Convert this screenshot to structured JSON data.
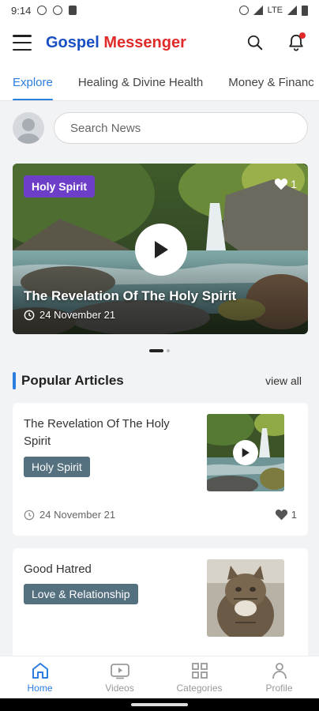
{
  "status_bar": {
    "time": "9:14",
    "network": "LTE"
  },
  "header": {
    "brand_part1": "Gospel",
    "brand_part2": "Messenger"
  },
  "tabs": [
    {
      "label": "Explore"
    },
    {
      "label": "Healing & Divine Health"
    },
    {
      "label": "Money & Financ"
    }
  ],
  "search": {
    "placeholder": "Search News"
  },
  "featured": {
    "tag": "Holy Spirit",
    "likes": "1",
    "title": "The Revelation Of The Holy Spirit",
    "date": "24 November 21"
  },
  "section": {
    "title": "Popular Articles",
    "view_all": "view all"
  },
  "articles": [
    {
      "title": "The Revelation Of The Holy Spirit",
      "tag": "Holy Spirit",
      "date": "24 November 21",
      "likes": "1"
    },
    {
      "title": "Good Hatred",
      "tag": "Love & Relationship"
    }
  ],
  "bottom_nav": [
    {
      "label": "Home"
    },
    {
      "label": "Videos"
    },
    {
      "label": "Categories"
    },
    {
      "label": "Profile"
    }
  ],
  "colors": {
    "accent": "#2b7de0",
    "brand_blue": "#1a4fc4",
    "brand_red": "#e02a2a",
    "tag_purple": "#6d3fc9",
    "tag_slate": "#55707f"
  }
}
